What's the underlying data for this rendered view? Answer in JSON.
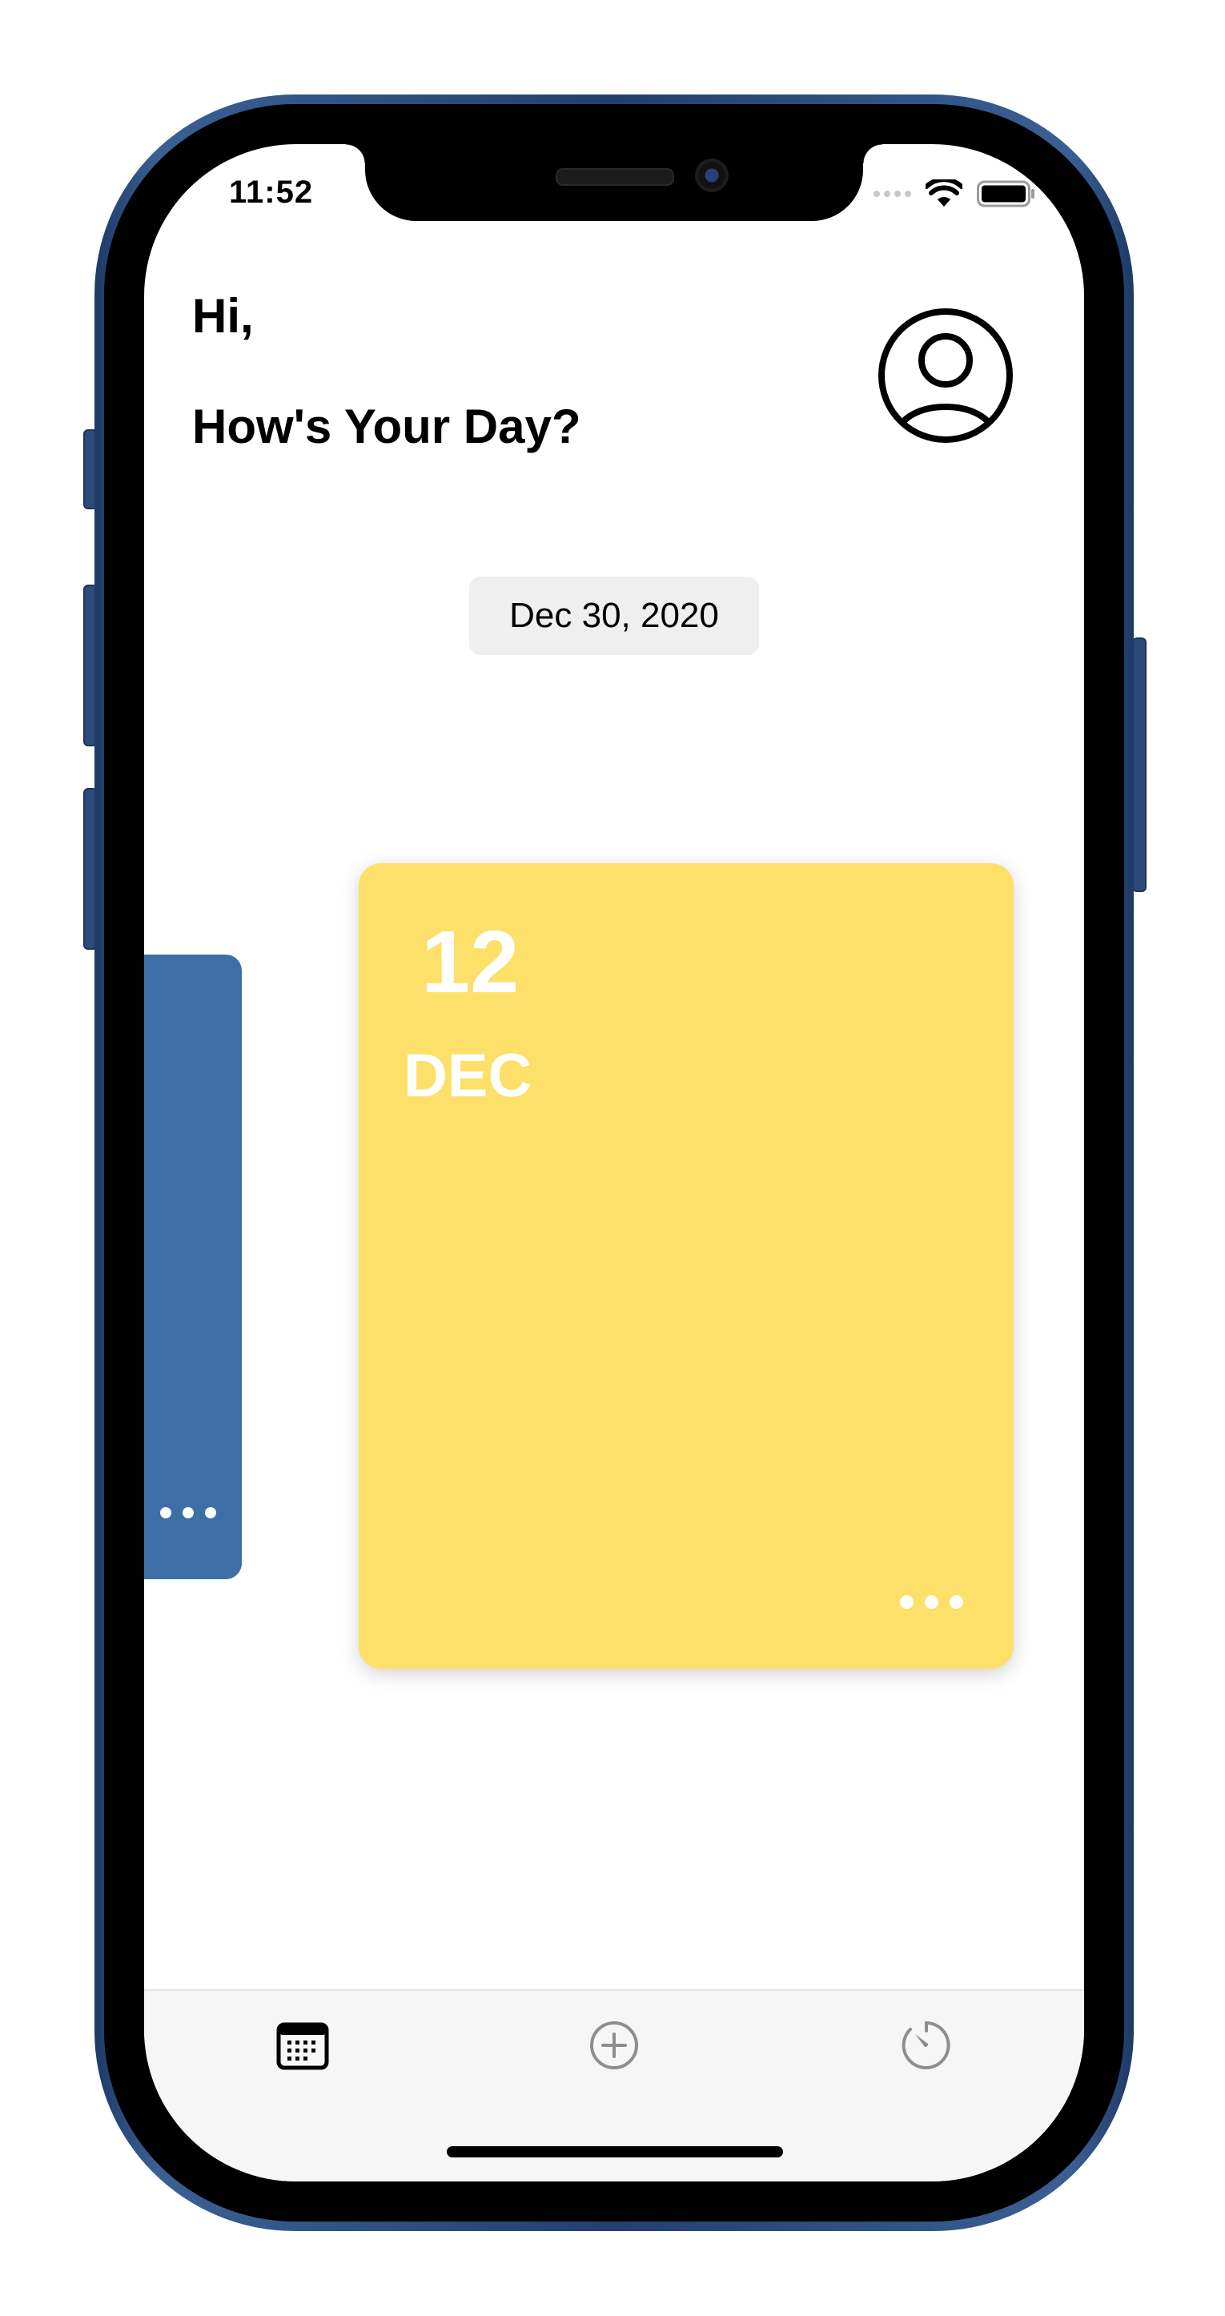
{
  "status_bar": {
    "time": "11:52",
    "icons": [
      "signal-dots-icon",
      "wifi-icon",
      "battery-icon"
    ]
  },
  "header": {
    "greeting": "Hi,",
    "question": "How's Your Day?",
    "avatar_icon": "user-profile-icon"
  },
  "date_selector": {
    "label": "Dec 30, 2020"
  },
  "cards": [
    {
      "day": "",
      "month": "",
      "color": "#3d6fa6",
      "menu_icon": "more-dots-icon"
    },
    {
      "day": "12",
      "month": "DEC",
      "color": "#fde069",
      "menu_icon": "more-dots-icon"
    }
  ],
  "tab_bar": {
    "tabs": [
      {
        "name": "calendar",
        "icon": "calendar-icon",
        "active": true
      },
      {
        "name": "add",
        "icon": "plus-circle-icon",
        "active": false
      },
      {
        "name": "timer",
        "icon": "timer-icon",
        "active": false
      }
    ]
  },
  "colors": {
    "accent_yellow": "#fde069",
    "accent_blue": "#3d6fa6",
    "frame_blue": "#2c4a7a",
    "tab_active": "#000000",
    "tab_inactive": "#8e8e8e"
  }
}
